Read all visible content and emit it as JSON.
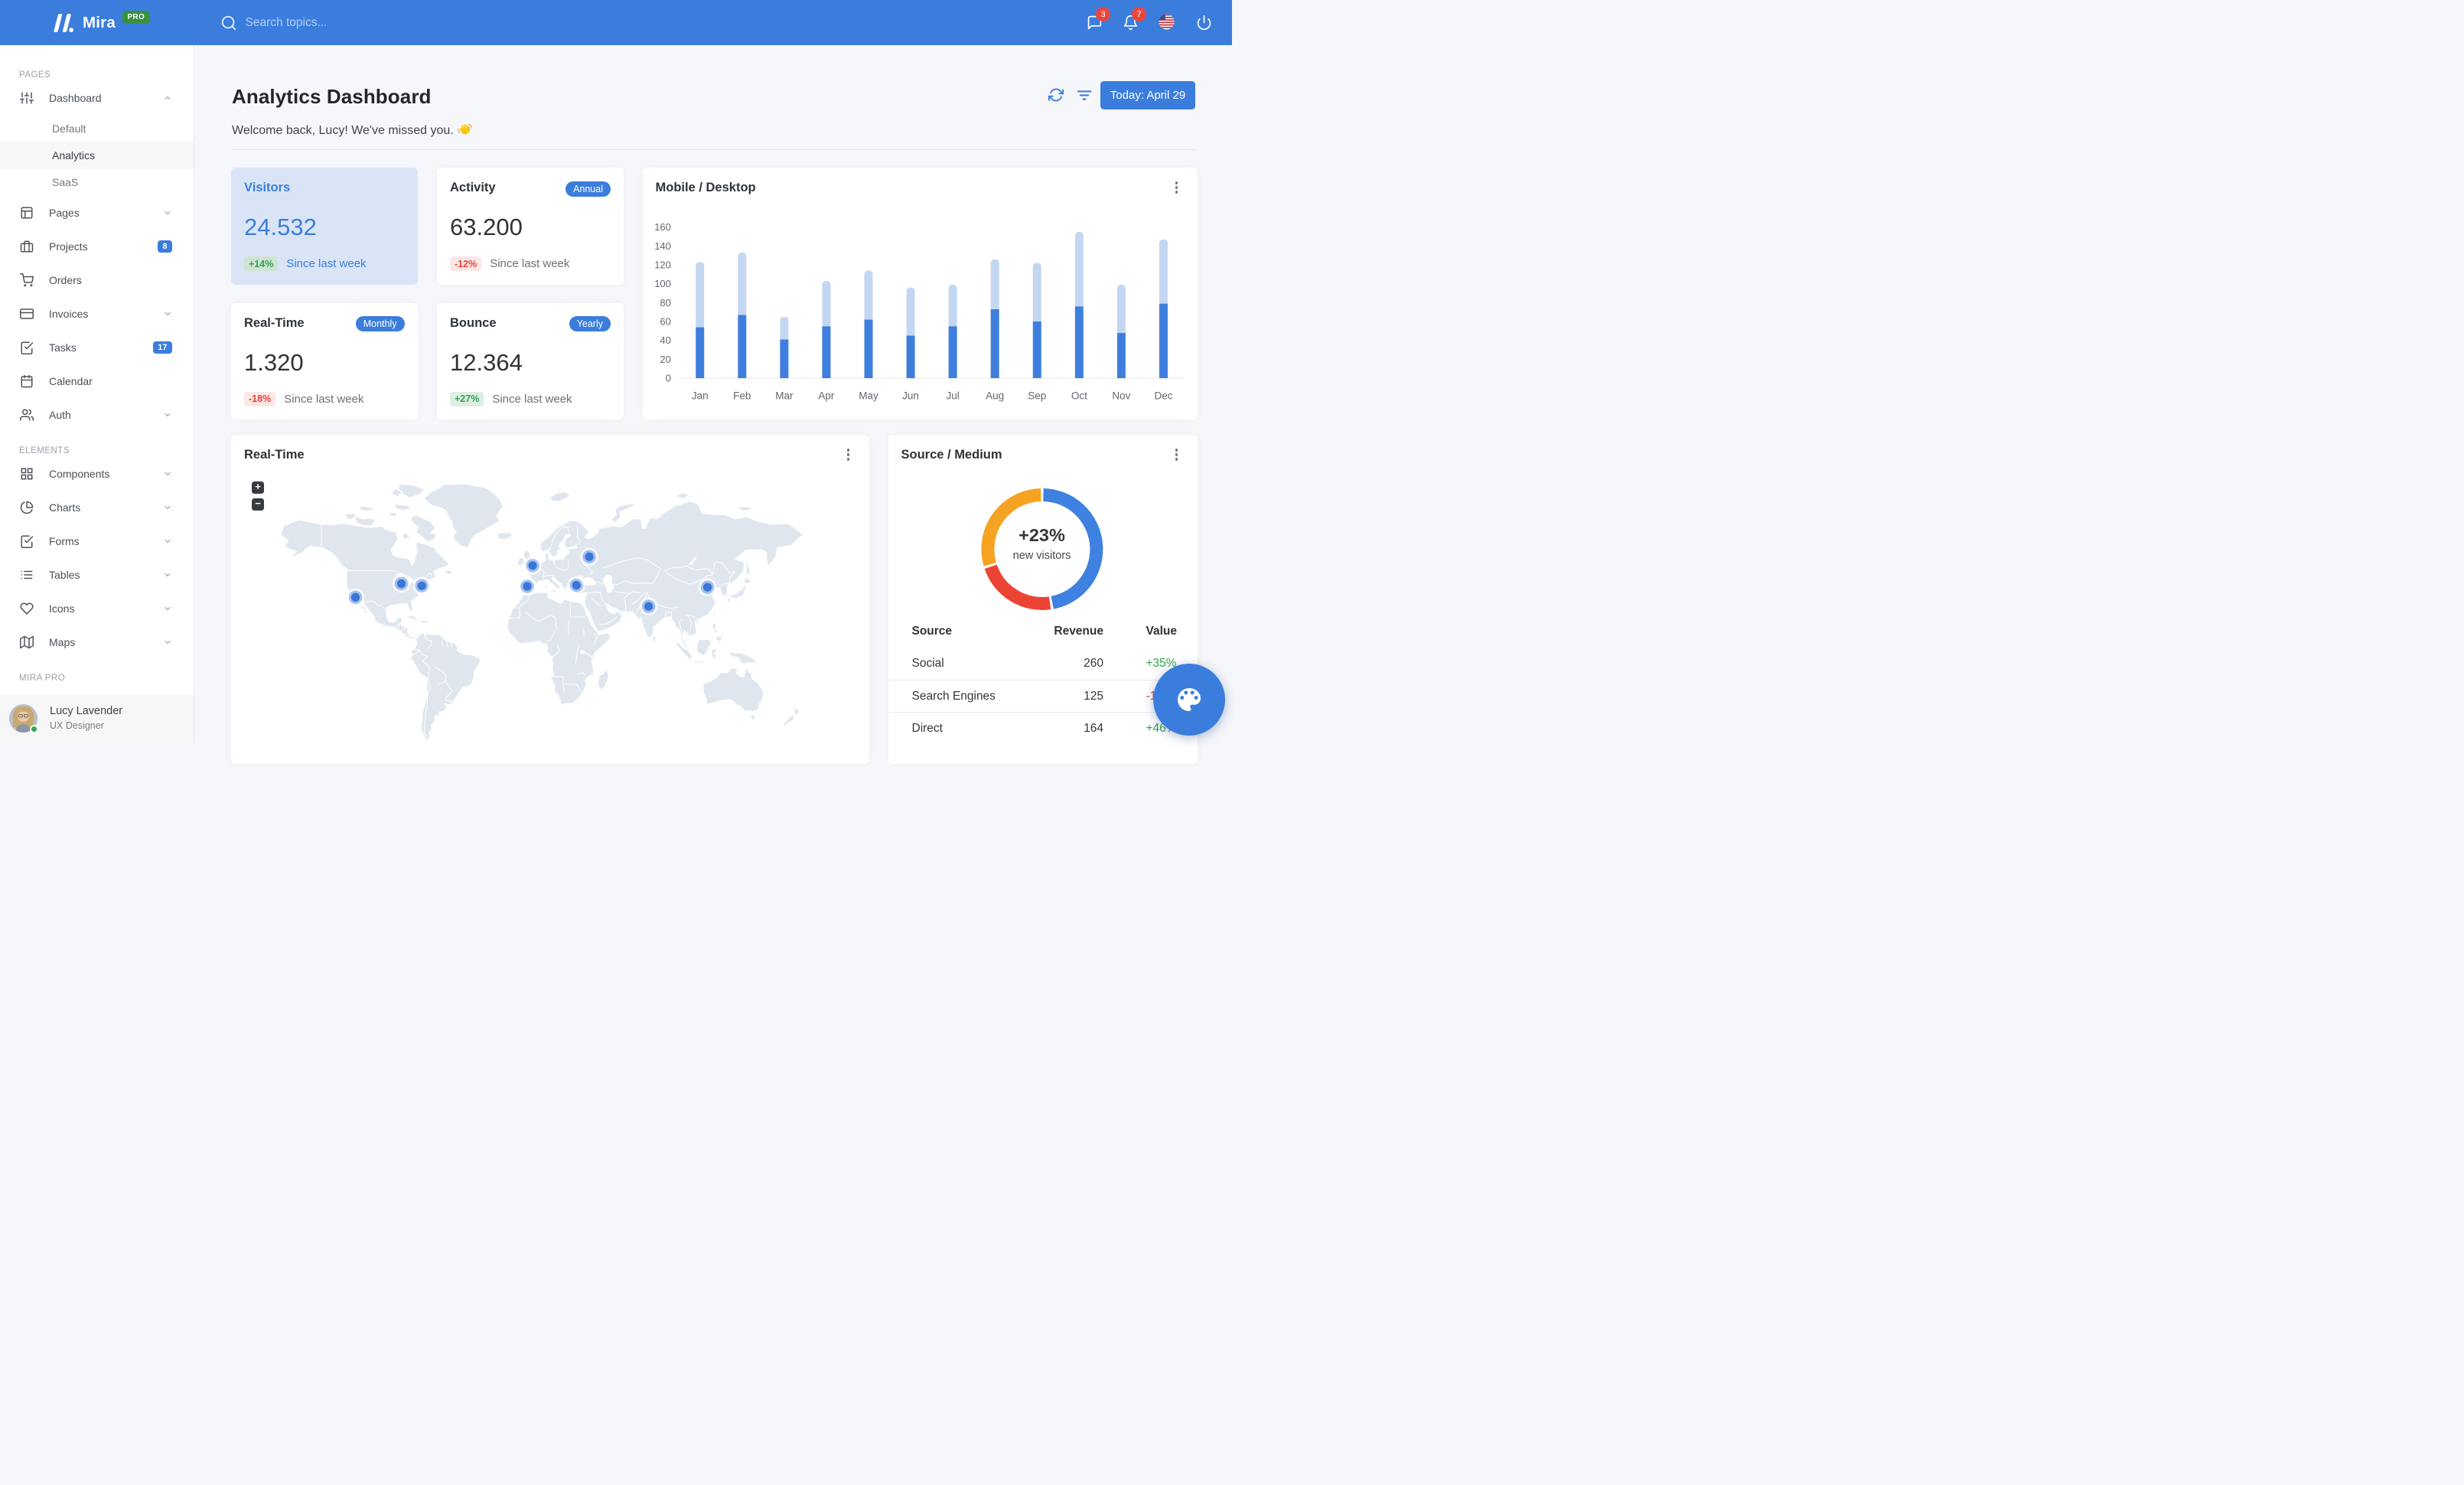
{
  "theme": {
    "primary": "#3B7DDD",
    "success": "#2DA44E",
    "danger": "#E3453B",
    "donut_blue": "#3F81E0",
    "donut_red": "#EC4434",
    "donut_orange": "#F6A321",
    "bar_dark": "#3E7FDE",
    "bar_light": "#C4D7F2",
    "land": "#E0E6EE"
  },
  "navbar": {
    "brand": "Mira",
    "brand_badge": "PRO",
    "search_placeholder": "Search topics...",
    "messages_badge": "3",
    "alerts_badge": "7",
    "icons": [
      "search-icon",
      "message-square-icon",
      "bell-icon",
      "us-flag-icon",
      "power-icon"
    ]
  },
  "sidebar": {
    "sections": [
      {
        "title": "PAGES",
        "items": [
          {
            "label": "Dashboard",
            "icon": "sliders",
            "chevron": "up",
            "children": [
              {
                "label": "Default"
              },
              {
                "label": "Analytics",
                "active": true
              },
              {
                "label": "SaaS"
              }
            ]
          },
          {
            "label": "Pages",
            "icon": "layout",
            "chevron": "down"
          },
          {
            "label": "Projects",
            "icon": "briefcase",
            "badge": "8"
          },
          {
            "label": "Orders",
            "icon": "shopping-cart"
          },
          {
            "label": "Invoices",
            "icon": "credit-card",
            "chevron": "down"
          },
          {
            "label": "Tasks",
            "icon": "check-square",
            "badge": "17"
          },
          {
            "label": "Calendar",
            "icon": "calendar"
          },
          {
            "label": "Auth",
            "icon": "users",
            "chevron": "down"
          }
        ]
      },
      {
        "title": "ELEMENTS",
        "items": [
          {
            "label": "Components",
            "icon": "grid",
            "chevron": "down"
          },
          {
            "label": "Charts",
            "icon": "pie-chart",
            "chevron": "down"
          },
          {
            "label": "Forms",
            "icon": "check-square",
            "chevron": "down"
          },
          {
            "label": "Tables",
            "icon": "list",
            "chevron": "down"
          },
          {
            "label": "Icons",
            "icon": "heart",
            "chevron": "down"
          },
          {
            "label": "Maps",
            "icon": "map",
            "chevron": "down"
          }
        ]
      },
      {
        "title": "MIRA PRO",
        "items": []
      }
    ],
    "user": {
      "name": "Lucy Lavender",
      "role": "UX Designer",
      "status": "online"
    }
  },
  "header": {
    "title": "Analytics Dashboard",
    "welcome": "Welcome back, Lucy! We've missed you.",
    "wave_emoji": "wave-hand",
    "date_button": "Today: April 29"
  },
  "stats": [
    {
      "title": "Visitors",
      "value": "24.532",
      "badge": null,
      "delta": "+14%",
      "note": "Since last week",
      "variant": "primary"
    },
    {
      "title": "Activity",
      "value": "63.200",
      "badge": "Annual",
      "delta": "-12%",
      "note": "Since last week",
      "variant": "white"
    },
    {
      "title": "Real-Time",
      "value": "1.320",
      "badge": "Monthly",
      "delta": "-18%",
      "note": "Since last week",
      "variant": "white"
    },
    {
      "title": "Bounce",
      "value": "12.364",
      "badge": "Yearly",
      "delta": "+27%",
      "note": "Since last week",
      "variant": "white"
    }
  ],
  "chart_data": [
    {
      "type": "bar",
      "title": "Mobile / Desktop",
      "stacked": true,
      "categories": [
        "Jan",
        "Feb",
        "Mar",
        "Apr",
        "May",
        "Jun",
        "Jul",
        "Aug",
        "Sep",
        "Oct",
        "Nov",
        "Dec"
      ],
      "series": [
        {
          "name": "Mobile",
          "values": [
            54,
            67,
            41,
            55,
            62,
            45,
            55,
            73,
            60,
            76,
            48,
            79
          ]
        },
        {
          "name": "Desktop",
          "values": [
            69,
            66,
            24,
            48,
            52,
            51,
            44,
            53,
            62,
            79,
            51,
            68
          ]
        }
      ],
      "ylim": [
        0,
        160
      ],
      "ytick": 20,
      "legend": "none",
      "grid": "off"
    },
    {
      "type": "pie",
      "title": "Source / Medium",
      "center_label": "+23%",
      "center_sub": "new visitors",
      "slices": [
        {
          "label": "Social",
          "value": 260,
          "color": "#3F81E0"
        },
        {
          "label": "Search Engines",
          "value": 125,
          "color": "#EC4434"
        },
        {
          "label": "Direct",
          "value": 164,
          "color": "#F6A321"
        }
      ]
    }
  ],
  "realtime": {
    "title": "Real-Time",
    "zoom_in": "+",
    "zoom_out": "−",
    "markers": [
      {
        "lon": -118.2,
        "lat": 34.05
      },
      {
        "lon": -87.6,
        "lat": 41.9
      },
      {
        "lon": -74.0,
        "lat": 40.7
      },
      {
        "lon": -0.1,
        "lat": 51.5
      },
      {
        "lon": -3.7,
        "lat": 40.4
      },
      {
        "lon": 37.6,
        "lat": 55.75
      },
      {
        "lon": 29.0,
        "lat": 41.0
      },
      {
        "lon": 77.2,
        "lat": 28.6
      },
      {
        "lon": 116.4,
        "lat": 39.9
      }
    ]
  },
  "source_table": {
    "headers": [
      "Source",
      "Revenue",
      "Value"
    ],
    "rows": [
      {
        "source": "Social",
        "revenue": "260",
        "value": "+35%"
      },
      {
        "source": "Search Engines",
        "revenue": "125",
        "value": "-12%"
      },
      {
        "source": "Direct",
        "revenue": "164",
        "value": "+46%"
      }
    ]
  }
}
